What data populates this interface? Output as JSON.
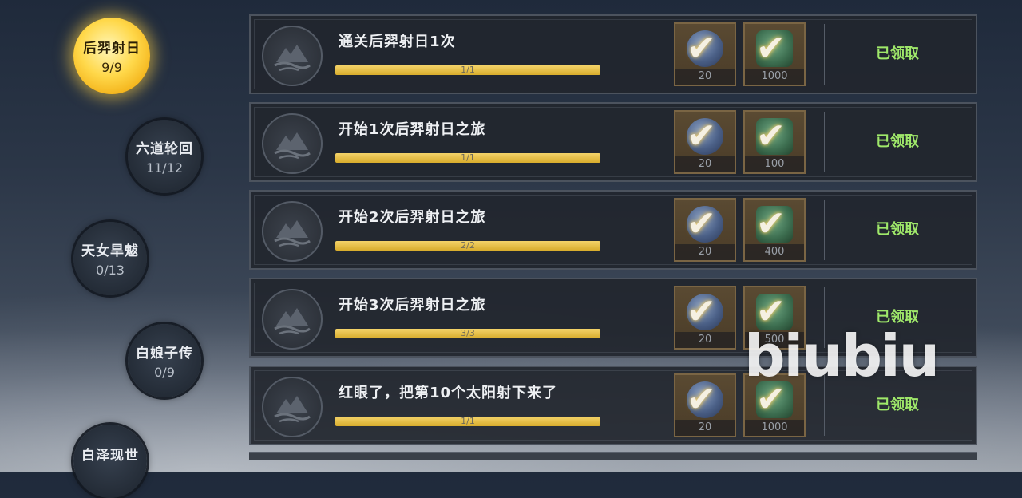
{
  "nav": [
    {
      "name": "后羿射日",
      "progress": "9/9",
      "active": true
    },
    {
      "name": "六道轮回",
      "progress": "11/12",
      "active": false
    },
    {
      "name": "天女旱魃",
      "progress": "0/13",
      "active": false
    },
    {
      "name": "白娘子传",
      "progress": "0/9",
      "active": false
    },
    {
      "name": "白泽现世",
      "progress": "",
      "active": false
    }
  ],
  "tasks": [
    {
      "title": "通关后羿射日1次",
      "progress_text": "1/1",
      "progress": 1.0,
      "rewards": [
        {
          "icon": "gem-icon",
          "qty": "20"
        },
        {
          "icon": "scroll-icon",
          "qty": "1000"
        }
      ],
      "status": "已领取"
    },
    {
      "title": "开始1次后羿射日之旅",
      "progress_text": "1/1",
      "progress": 1.0,
      "rewards": [
        {
          "icon": "gem-icon",
          "qty": "20"
        },
        {
          "icon": "scroll-icon",
          "qty": "100"
        }
      ],
      "status": "已领取"
    },
    {
      "title": "开始2次后羿射日之旅",
      "progress_text": "2/2",
      "progress": 1.0,
      "rewards": [
        {
          "icon": "gem-icon",
          "qty": "20"
        },
        {
          "icon": "scroll-icon",
          "qty": "400"
        }
      ],
      "status": "已领取"
    },
    {
      "title": "开始3次后羿射日之旅",
      "progress_text": "3/3",
      "progress": 1.0,
      "rewards": [
        {
          "icon": "gem-icon",
          "qty": "20"
        },
        {
          "icon": "scroll-icon",
          "qty": "500"
        }
      ],
      "status": "已领取"
    },
    {
      "title": "红眼了，把第10个太阳射下来了",
      "progress_text": "1/1",
      "progress": 1.0,
      "rewards": [
        {
          "icon": "gem-icon",
          "qty": "20"
        },
        {
          "icon": "scroll-icon",
          "qty": "1000"
        }
      ],
      "status": "已领取"
    }
  ],
  "watermark": "biubiu",
  "colors": {
    "claimed": "#9fe86a",
    "progress": "#e8c24a",
    "active_badge": "#ffd84a"
  }
}
